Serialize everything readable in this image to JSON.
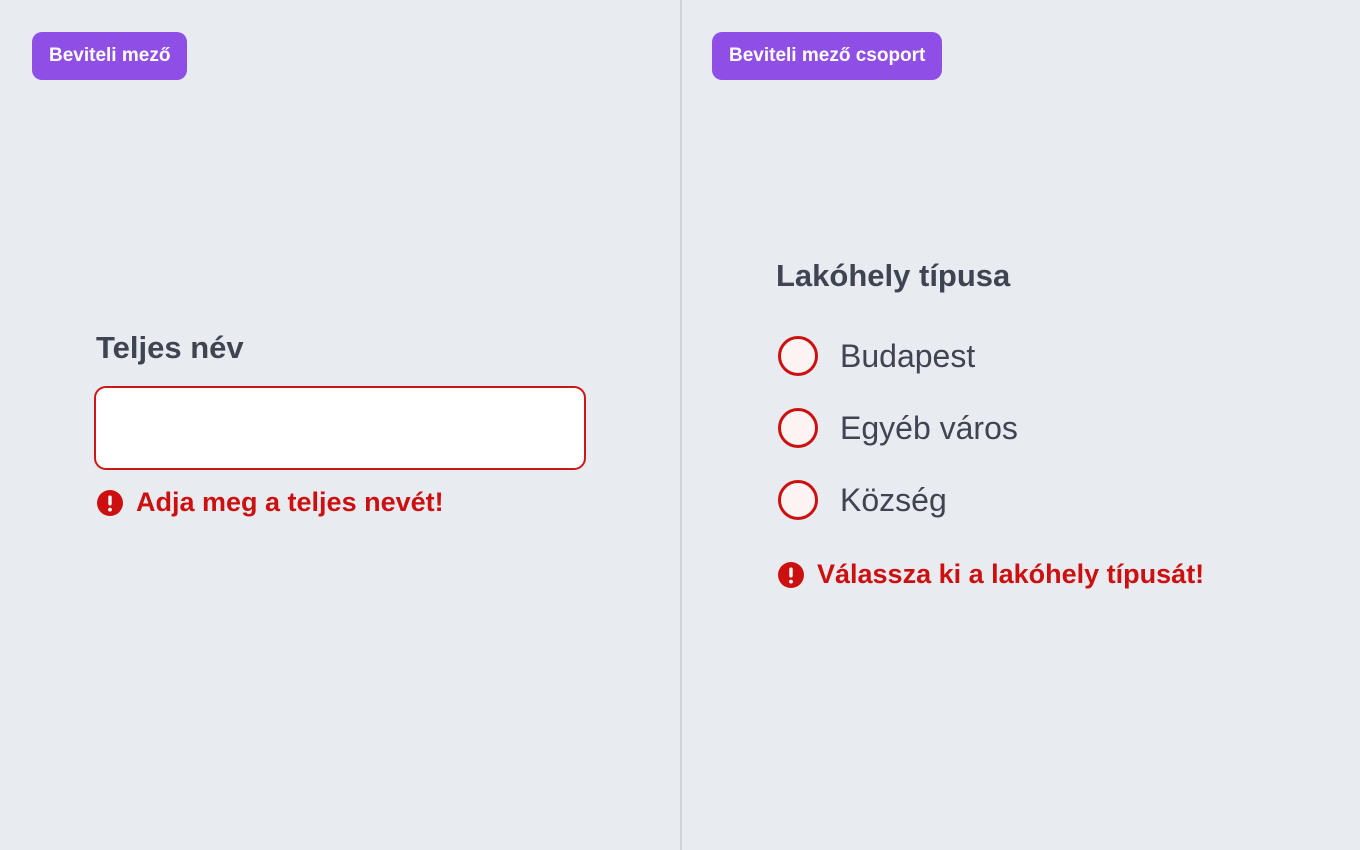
{
  "left_panel": {
    "tag": "Beviteli mező",
    "field": {
      "label": "Teljes név",
      "value": "",
      "error": "Adja meg a teljes nevét!"
    }
  },
  "right_panel": {
    "tag": "Beviteli mező csoport",
    "group": {
      "label": "Lakóhely típusa",
      "options": [
        {
          "label": "Budapest",
          "selected": false
        },
        {
          "label": "Egyéb város",
          "selected": false
        },
        {
          "label": "Község",
          "selected": false
        }
      ],
      "error": "Válassza ki a lakóhely típusát!"
    }
  },
  "colors": {
    "background": "#e8ebf0",
    "tag": "#8f4fe6",
    "error": "#cc1010",
    "text": "#3f4453"
  },
  "icons": {
    "error": "error-exclamation-icon"
  }
}
